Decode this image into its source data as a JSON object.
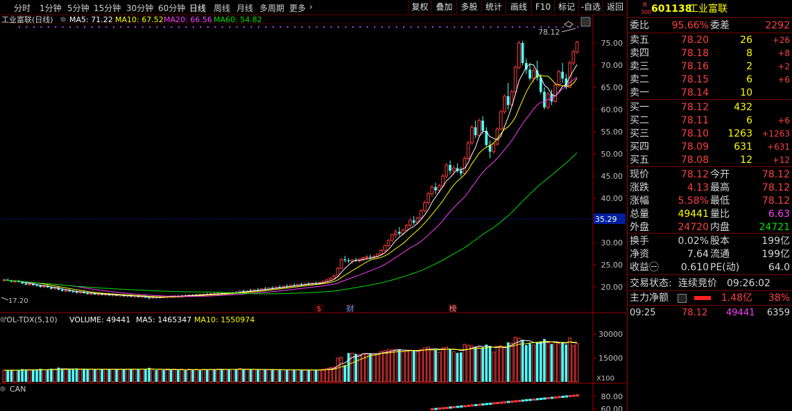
{
  "toolbar": {
    "periods": [
      "分时",
      "1分钟",
      "5分钟",
      "15分钟",
      "30分钟",
      "60分钟",
      "日线",
      "周线",
      "月线",
      "多周期",
      "更多"
    ],
    "active": "日线",
    "right_buttons": [
      "复权",
      "叠加",
      "多股",
      "统计",
      "画线",
      "F10",
      "标记",
      "-自选",
      "返回"
    ]
  },
  "main_chart": {
    "title": "工业富联(日线)",
    "ma_legend": [
      {
        "label": "MA5: 71.22",
        "color": "#ffffff"
      },
      {
        "label": "MA10: 67.52",
        "color": "#ffff00"
      },
      {
        "label": "MA20: 66.56",
        "color": "#ff40ff"
      },
      {
        "label": "MA60: 54.82",
        "color": "#00e000"
      }
    ],
    "y_ticks": [
      "75.00",
      "70.00",
      "65.00",
      "60.00",
      "55.00",
      "50.00",
      "45.00",
      "40.00",
      "35.00",
      "30.00",
      "25.00",
      "20.00"
    ],
    "cursor_price": "35.29",
    "low_marker": "17.20",
    "high_marker": "78.12",
    "event_marks": [
      {
        "text": "$",
        "color": "#ff4040"
      },
      {
        "text": "财",
        "color": "#40a0ff"
      },
      {
        "text": "榜",
        "color": "#ff8080"
      }
    ]
  },
  "volume_panel": {
    "title": "VOL-TDX(5,10)",
    "legend": [
      {
        "label": "VOLUME: 49441",
        "color": "#ffffff"
      },
      {
        "label": "MA5: 1465347",
        "color": "#ffffff"
      },
      {
        "label": "MA10: 1550974",
        "color": "#ffff00"
      }
    ],
    "y_ticks": [
      "30000",
      "15000"
    ],
    "unit": "X100"
  },
  "can_panel": {
    "title": "CAN",
    "y_ticks": [
      "80.00",
      "60.00"
    ]
  },
  "side": {
    "code": "601138",
    "name": "工业富联",
    "tag_r": "R",
    "tag_num": "300",
    "weibi_label": "委比",
    "weibi_value": "95.66%",
    "weicha_label": "委差",
    "weicha_value": "2292",
    "asks": [
      {
        "label": "卖五",
        "price": "78.20",
        "vol": "26",
        "chg": "+26"
      },
      {
        "label": "卖四",
        "price": "78.18",
        "vol": "8",
        "chg": "+8"
      },
      {
        "label": "卖三",
        "price": "78.16",
        "vol": "2",
        "chg": "+2"
      },
      {
        "label": "卖二",
        "price": "78.15",
        "vol": "6",
        "chg": "+6"
      },
      {
        "label": "卖一",
        "price": "78.14",
        "vol": "10",
        "chg": ""
      }
    ],
    "bids": [
      {
        "label": "买一",
        "price": "78.12",
        "vol": "432",
        "chg": ""
      },
      {
        "label": "买二",
        "price": "78.11",
        "vol": "6",
        "chg": "+6"
      },
      {
        "label": "买三",
        "price": "78.10",
        "vol": "1263",
        "chg": "+1263"
      },
      {
        "label": "买四",
        "price": "78.09",
        "vol": "631",
        "chg": "+631"
      },
      {
        "label": "买五",
        "price": "78.08",
        "vol": "12",
        "chg": "+12"
      }
    ],
    "quote": [
      {
        "l1": "现价",
        "v1": "78.12",
        "c1": "red",
        "l2": "今开",
        "v2": "78.12",
        "c2": "red"
      },
      {
        "l1": "涨跌",
        "v1": "4.13",
        "c1": "red",
        "l2": "最高",
        "v2": "78.12",
        "c2": "red"
      },
      {
        "l1": "涨幅",
        "v1": "5.58%",
        "c1": "red",
        "l2": "最低",
        "v2": "78.12",
        "c2": "red"
      },
      {
        "l1": "总量",
        "v1": "49441",
        "c1": "yellow",
        "l2": "量比",
        "v2": "6.63",
        "c2": "mag"
      },
      {
        "l1": "外盘",
        "v1": "24720",
        "c1": "red",
        "l2": "内盘",
        "v2": "24721",
        "c2": "green"
      }
    ],
    "fund": [
      {
        "l1": "换手",
        "v1": "0.02%",
        "l2": "股本",
        "v2": "199亿"
      },
      {
        "l1": "净资",
        "v1": "7.64",
        "l2": "流通",
        "v2": "199亿"
      },
      {
        "l1": "收益㊀",
        "v1": "0.610",
        "l2": "PE(动)",
        "v2": "64.0"
      }
    ],
    "trade_status_label": "交易状态:",
    "trade_status_value": "连续竞价",
    "trade_time": "09:26:02",
    "main_net_label": "主力净额",
    "main_net_value": "1.48亿",
    "main_net_pct": "38%",
    "tick": {
      "time": "09:25",
      "price": "78.12",
      "vol": "49441",
      "num": "6359"
    }
  },
  "colors": {
    "up": "#ff3c3c",
    "down": "#54ffff",
    "ma5": "#ffffff",
    "ma10": "#ffff00",
    "ma20": "#ff40ff",
    "ma60": "#00e000",
    "grid": "#5a0000"
  },
  "chart_data": {
    "type": "candlestick",
    "title": "工业富联(日线)",
    "ohlc": [
      [
        21.5,
        21.8,
        21.2,
        21.6
      ],
      [
        21.6,
        21.9,
        21.3,
        21.4
      ],
      [
        21.4,
        21.6,
        21.0,
        21.2
      ],
      [
        21.2,
        21.5,
        20.9,
        21.3
      ],
      [
        21.3,
        21.6,
        21.0,
        21.1
      ],
      [
        21.1,
        21.3,
        20.6,
        20.8
      ],
      [
        20.8,
        21.0,
        20.4,
        20.5
      ],
      [
        20.5,
        20.8,
        20.2,
        20.7
      ],
      [
        20.7,
        20.9,
        20.3,
        20.4
      ],
      [
        20.4,
        20.7,
        20.1,
        20.3
      ],
      [
        20.3,
        20.5,
        19.8,
        20.0
      ],
      [
        20.0,
        20.3,
        19.7,
        20.2
      ],
      [
        20.2,
        20.4,
        19.8,
        19.9
      ],
      [
        19.9,
        20.1,
        19.4,
        19.6
      ],
      [
        19.6,
        19.9,
        19.3,
        19.8
      ],
      [
        19.8,
        20.0,
        19.2,
        19.4
      ],
      [
        19.4,
        19.7,
        19.0,
        19.1
      ],
      [
        19.1,
        19.4,
        18.8,
        19.2
      ],
      [
        19.2,
        19.5,
        18.9,
        19.0
      ],
      [
        19.0,
        19.3,
        18.7,
        18.9
      ],
      [
        18.9,
        19.2,
        18.5,
        18.7
      ],
      [
        18.7,
        19.0,
        18.4,
        18.9
      ],
      [
        18.9,
        19.1,
        18.5,
        18.6
      ],
      [
        18.6,
        18.9,
        18.3,
        18.4
      ],
      [
        18.4,
        18.7,
        18.1,
        18.6
      ],
      [
        18.6,
        18.8,
        18.2,
        18.3
      ],
      [
        18.3,
        18.6,
        18.0,
        18.5
      ],
      [
        18.5,
        18.7,
        18.1,
        18.2
      ],
      [
        18.2,
        18.5,
        17.9,
        18.4
      ],
      [
        18.4,
        18.6,
        18.0,
        18.1
      ],
      [
        18.1,
        18.4,
        17.8,
        18.3
      ],
      [
        18.3,
        18.5,
        17.9,
        18.0
      ],
      [
        18.0,
        18.3,
        17.7,
        18.2
      ],
      [
        18.2,
        18.4,
        17.8,
        17.9
      ],
      [
        17.9,
        18.2,
        17.6,
        18.1
      ],
      [
        18.1,
        18.3,
        17.7,
        17.8
      ],
      [
        17.8,
        18.1,
        17.5,
        18.0
      ],
      [
        18.0,
        18.2,
        17.6,
        17.7
      ],
      [
        17.7,
        18.0,
        17.4,
        17.9
      ],
      [
        17.9,
        18.1,
        17.5,
        17.6
      ],
      [
        17.6,
        17.9,
        17.2,
        17.5
      ],
      [
        17.5,
        17.8,
        17.3,
        17.7
      ],
      [
        17.7,
        17.9,
        17.4,
        17.6
      ],
      [
        17.6,
        17.9,
        17.3,
        17.8
      ],
      [
        17.8,
        18.0,
        17.5,
        17.7
      ],
      [
        17.7,
        18.0,
        17.4,
        17.9
      ],
      [
        17.9,
        18.1,
        17.6,
        17.8
      ],
      [
        17.8,
        18.1,
        17.5,
        18.0
      ],
      [
        18.0,
        18.2,
        17.7,
        17.9
      ],
      [
        17.9,
        18.2,
        17.6,
        18.1
      ],
      [
        18.1,
        18.3,
        17.8,
        18.0
      ],
      [
        18.0,
        18.3,
        17.7,
        18.2
      ],
      [
        18.2,
        18.4,
        17.9,
        18.1
      ],
      [
        18.1,
        18.4,
        17.8,
        18.3
      ],
      [
        18.3,
        18.5,
        18.0,
        18.2
      ],
      [
        18.2,
        18.5,
        17.9,
        18.4
      ],
      [
        18.4,
        18.7,
        18.1,
        18.3
      ],
      [
        18.3,
        18.6,
        18.0,
        18.5
      ],
      [
        18.5,
        18.8,
        18.2,
        18.4
      ],
      [
        18.4,
        18.7,
        18.1,
        18.6
      ],
      [
        18.6,
        18.9,
        18.3,
        18.5
      ],
      [
        18.5,
        18.8,
        18.2,
        18.7
      ],
      [
        18.7,
        19.0,
        18.4,
        18.6
      ],
      [
        18.6,
        18.9,
        18.3,
        18.8
      ],
      [
        18.8,
        19.1,
        18.5,
        18.7
      ],
      [
        18.7,
        19.2,
        18.5,
        19.1
      ],
      [
        19.1,
        19.4,
        18.8,
        18.9
      ],
      [
        18.9,
        19.3,
        18.7,
        19.2
      ],
      [
        19.2,
        19.6,
        19.0,
        19.1
      ],
      [
        19.1,
        19.5,
        18.9,
        19.4
      ],
      [
        19.4,
        19.8,
        19.2,
        19.3
      ],
      [
        19.3,
        19.7,
        19.1,
        19.6
      ],
      [
        19.6,
        20.0,
        19.4,
        19.5
      ],
      [
        19.5,
        19.9,
        19.3,
        19.8
      ],
      [
        19.8,
        20.2,
        19.6,
        19.7
      ],
      [
        19.7,
        20.1,
        19.5,
        20.0
      ],
      [
        20.0,
        20.4,
        19.8,
        19.9
      ],
      [
        19.9,
        20.3,
        19.7,
        20.2
      ],
      [
        20.2,
        20.6,
        20.0,
        20.1
      ],
      [
        20.1,
        20.5,
        19.9,
        20.4
      ],
      [
        20.4,
        20.8,
        20.2,
        20.3
      ],
      [
        20.3,
        20.7,
        20.1,
        20.6
      ],
      [
        20.6,
        21.0,
        20.4,
        20.5
      ],
      [
        20.5,
        20.9,
        20.3,
        20.8
      ],
      [
        20.8,
        21.1,
        20.5,
        20.7
      ],
      [
        20.7,
        21.0,
        20.4,
        20.9
      ],
      [
        20.9,
        21.2,
        20.6,
        20.8
      ],
      [
        20.8,
        21.1,
        20.5,
        21.0
      ],
      [
        21.0,
        21.4,
        20.7,
        21.3
      ],
      [
        21.3,
        21.8,
        21.0,
        21.6
      ],
      [
        21.6,
        22.2,
        21.3,
        22.0
      ],
      [
        22.0,
        22.8,
        21.8,
        22.5
      ],
      [
        22.5,
        24.5,
        22.3,
        24.2
      ],
      [
        24.2,
        26.5,
        24.0,
        26.2
      ],
      [
        26.2,
        27.0,
        25.6,
        26.0
      ],
      [
        26.0,
        26.5,
        25.4,
        25.8
      ],
      [
        25.8,
        26.3,
        25.2,
        26.1
      ],
      [
        26.1,
        26.6,
        25.6,
        25.9
      ],
      [
        25.9,
        26.4,
        25.5,
        26.3
      ],
      [
        26.3,
        26.8,
        25.8,
        26.6
      ],
      [
        26.6,
        27.2,
        26.1,
        26.8
      ],
      [
        26.8,
        27.3,
        26.2,
        26.7
      ],
      [
        26.7,
        27.2,
        26.2,
        26.9
      ],
      [
        26.9,
        27.5,
        26.4,
        27.4
      ],
      [
        27.4,
        28.5,
        27.1,
        28.2
      ],
      [
        28.2,
        29.5,
        27.9,
        29.3
      ],
      [
        29.3,
        30.8,
        29.0,
        30.5
      ],
      [
        30.5,
        32.0,
        30.1,
        31.8
      ],
      [
        31.8,
        33.0,
        31.0,
        32.4
      ],
      [
        32.4,
        33.5,
        31.5,
        32.0
      ],
      [
        32.0,
        33.2,
        31.6,
        32.8
      ],
      [
        32.8,
        34.2,
        32.4,
        33.9
      ],
      [
        33.9,
        35.5,
        33.5,
        35.0
      ],
      [
        35.0,
        36.0,
        34.0,
        34.5
      ],
      [
        34.5,
        35.8,
        34.1,
        35.6
      ],
      [
        35.6,
        37.5,
        35.2,
        37.2
      ],
      [
        37.2,
        39.5,
        36.8,
        39.0
      ],
      [
        39.0,
        41.5,
        38.5,
        41.0
      ],
      [
        41.0,
        43.0,
        40.3,
        42.5
      ],
      [
        42.5,
        43.5,
        41.0,
        41.8
      ],
      [
        41.8,
        43.2,
        41.2,
        42.8
      ],
      [
        42.8,
        45.5,
        42.4,
        45.0
      ],
      [
        45.0,
        48.0,
        44.5,
        47.5
      ],
      [
        47.5,
        48.5,
        45.5,
        46.2
      ],
      [
        46.2,
        47.5,
        45.2,
        46.8
      ],
      [
        46.8,
        47.8,
        45.8,
        46.2
      ],
      [
        46.2,
        47.0,
        44.9,
        45.6
      ],
      [
        45.6,
        49.5,
        45.2,
        49.0
      ],
      [
        49.0,
        53.0,
        48.6,
        52.5
      ],
      [
        52.5,
        56.5,
        52.0,
        56.0
      ],
      [
        56.0,
        57.5,
        53.5,
        54.2
      ],
      [
        54.2,
        58.0,
        53.8,
        57.5
      ],
      [
        57.5,
        58.5,
        54.5,
        55.2
      ],
      [
        55.2,
        56.0,
        51.5,
        52.0
      ],
      [
        52.0,
        53.0,
        49.0,
        50.5
      ],
      [
        50.5,
        52.5,
        50.0,
        52.2
      ],
      [
        52.2,
        56.0,
        51.8,
        55.6
      ],
      [
        55.6,
        60.0,
        55.2,
        59.5
      ],
      [
        59.5,
        63.5,
        59.0,
        63.0
      ],
      [
        63.0,
        66.0,
        60.0,
        61.0
      ],
      [
        61.0,
        64.5,
        60.6,
        64.0
      ],
      [
        64.0,
        70.0,
        63.6,
        69.5
      ],
      [
        69.5,
        75.5,
        69.0,
        75.0
      ],
      [
        75.0,
        75.5,
        70.0,
        70.5
      ],
      [
        70.5,
        71.5,
        68.0,
        69.0
      ],
      [
        69.0,
        70.5,
        66.5,
        67.0
      ],
      [
        67.0,
        69.5,
        66.0,
        68.8
      ],
      [
        68.8,
        71.0,
        66.5,
        67.2
      ],
      [
        67.2,
        68.0,
        63.5,
        64.0
      ],
      [
        64.0,
        65.0,
        60.0,
        60.5
      ],
      [
        60.5,
        64.0,
        60.0,
        63.5
      ],
      [
        63.5,
        64.5,
        61.0,
        61.8
      ],
      [
        61.8,
        66.0,
        61.5,
        65.5
      ],
      [
        65.5,
        69.0,
        65.0,
        68.5
      ],
      [
        68.5,
        70.5,
        66.0,
        67.0
      ],
      [
        67.0,
        68.0,
        64.5,
        65.0
      ],
      [
        65.0,
        71.0,
        64.8,
        70.5
      ],
      [
        70.5,
        73.5,
        70.0,
        73.0
      ],
      [
        73.0,
        75.5,
        72.5,
        75.2
      ]
    ],
    "ylim": [
      17.2,
      78.12
    ],
    "y_ticks": [
      75,
      70,
      65,
      60,
      55,
      50,
      45,
      40,
      35,
      30,
      25,
      20
    ],
    "series": [
      {
        "name": "MA5",
        "color": "#ffffff"
      },
      {
        "name": "MA10",
        "color": "#ffff00"
      },
      {
        "name": "MA20",
        "color": "#ff40ff"
      },
      {
        "name": "MA60",
        "color": "#00e000"
      }
    ],
    "volume_ylim": [
      0,
      35000
    ],
    "grid": false
  }
}
